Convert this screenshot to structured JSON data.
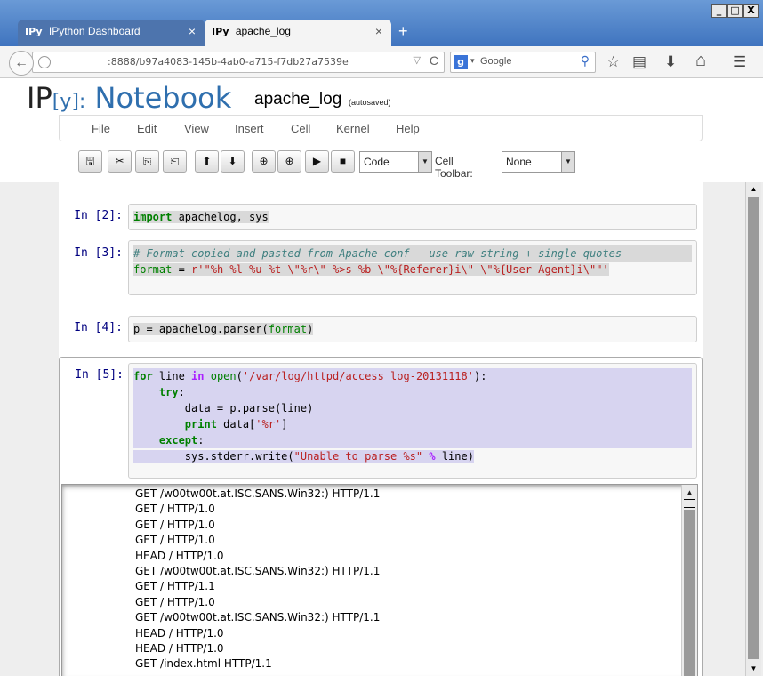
{
  "window": {
    "minimize": "_",
    "maximize": "□",
    "close": "X"
  },
  "tabs": [
    {
      "icon_text": "IPy",
      "label": "IPython Dashboard",
      "close": "×"
    },
    {
      "icon_text": "IPy",
      "label": "apache_log",
      "close": "×"
    }
  ],
  "new_tab": "+",
  "nav": {
    "back_icon": "←",
    "url": ":8888/b97a4083-145b-4ab0-a715-f7db27a7539e",
    "dropdown": "▽",
    "reload": "C",
    "search_engine_icon": "g",
    "search_dropdown": "▾",
    "search_placeholder": "Google",
    "search_icon": "⚲",
    "star": "☆",
    "bookmarks": "▤",
    "download": "⬇",
    "home": "⌂",
    "menu": "☰"
  },
  "notebook": {
    "logo_ip": "IP",
    "logo_y": "[y]:",
    "logo_notebook": "Notebook",
    "name": "apache_log",
    "autosave": "(autosaved)"
  },
  "menus": [
    "File",
    "Edit",
    "View",
    "Insert",
    "Cell",
    "Kernel",
    "Help"
  ],
  "toolbar": {
    "save": "🖫",
    "cut": "✂",
    "copy": "⎘",
    "paste": "⎗",
    "move_up": "⬆",
    "move_down": "⬇",
    "run_up": "⊕",
    "run_down": "⊕",
    "run": "▶",
    "stop": "■",
    "cell_type": "Code",
    "cell_toolbar_label": "Cell Toolbar:",
    "cell_toolbar_value": "None",
    "dropdown_arrow": "▼"
  },
  "cells": [
    {
      "prompt": "In [2]:"
    },
    {
      "prompt": "In [3]:"
    },
    {
      "prompt": "In [4]:"
    },
    {
      "prompt": "In [5]:"
    }
  ],
  "code": {
    "c2_import": "import",
    "c2_rest": " apachelog, sys",
    "c3_comment": "# Format copied and pasted from Apache conf - use raw string + single quotes",
    "c3_var": "format",
    "c3_eq": " = ",
    "c3_str": "r'\"%h %l %u %t \\\"%r\\\" %>s %b \\\"%{Referer}i\\\" \\\"%{User-Agent}i\\\"\"'",
    "c4_a": "p = apachelog.parser(",
    "c4_builtin": "format",
    "c4_b": ")",
    "c5_for": "for",
    "c5_line": " line ",
    "c5_in": "in",
    "c5_sp": " ",
    "c5_open": "open",
    "c5_lp": "(",
    "c5_path": "'/var/log/httpd/access_log-20131118'",
    "c5_rp": "):",
    "c5_try": "try",
    "c5_colon": ":",
    "c5_data": "data = p.parse(line)",
    "c5_print": "print",
    "c5_data2a": " data[",
    "c5_key": "'%r'",
    "c5_data2b": "]",
    "c5_except": "except",
    "c5_write_a": "sys.stderr.write(",
    "c5_msg": "\"Unable to parse %s\"",
    "c5_pct": "%",
    "c5_write_b": " line)"
  },
  "output": {
    "lines": [
      "GET /w00tw00t.at.ISC.SANS.Win32:) HTTP/1.1",
      "GET / HTTP/1.0",
      "GET / HTTP/1.0",
      "GET / HTTP/1.0",
      "HEAD / HTTP/1.0",
      "GET /w00tw00t.at.ISC.SANS.Win32:) HTTP/1.1",
      "GET / HTTP/1.1",
      "GET / HTTP/1.0",
      "GET /w00tw00t.at.ISC.SANS.Win32:) HTTP/1.1",
      "HEAD / HTTP/1.0",
      "HEAD / HTTP/1.0",
      "GET /index.html HTTP/1.1"
    ]
  },
  "scroll": {
    "up": "▲",
    "down": "▼"
  }
}
